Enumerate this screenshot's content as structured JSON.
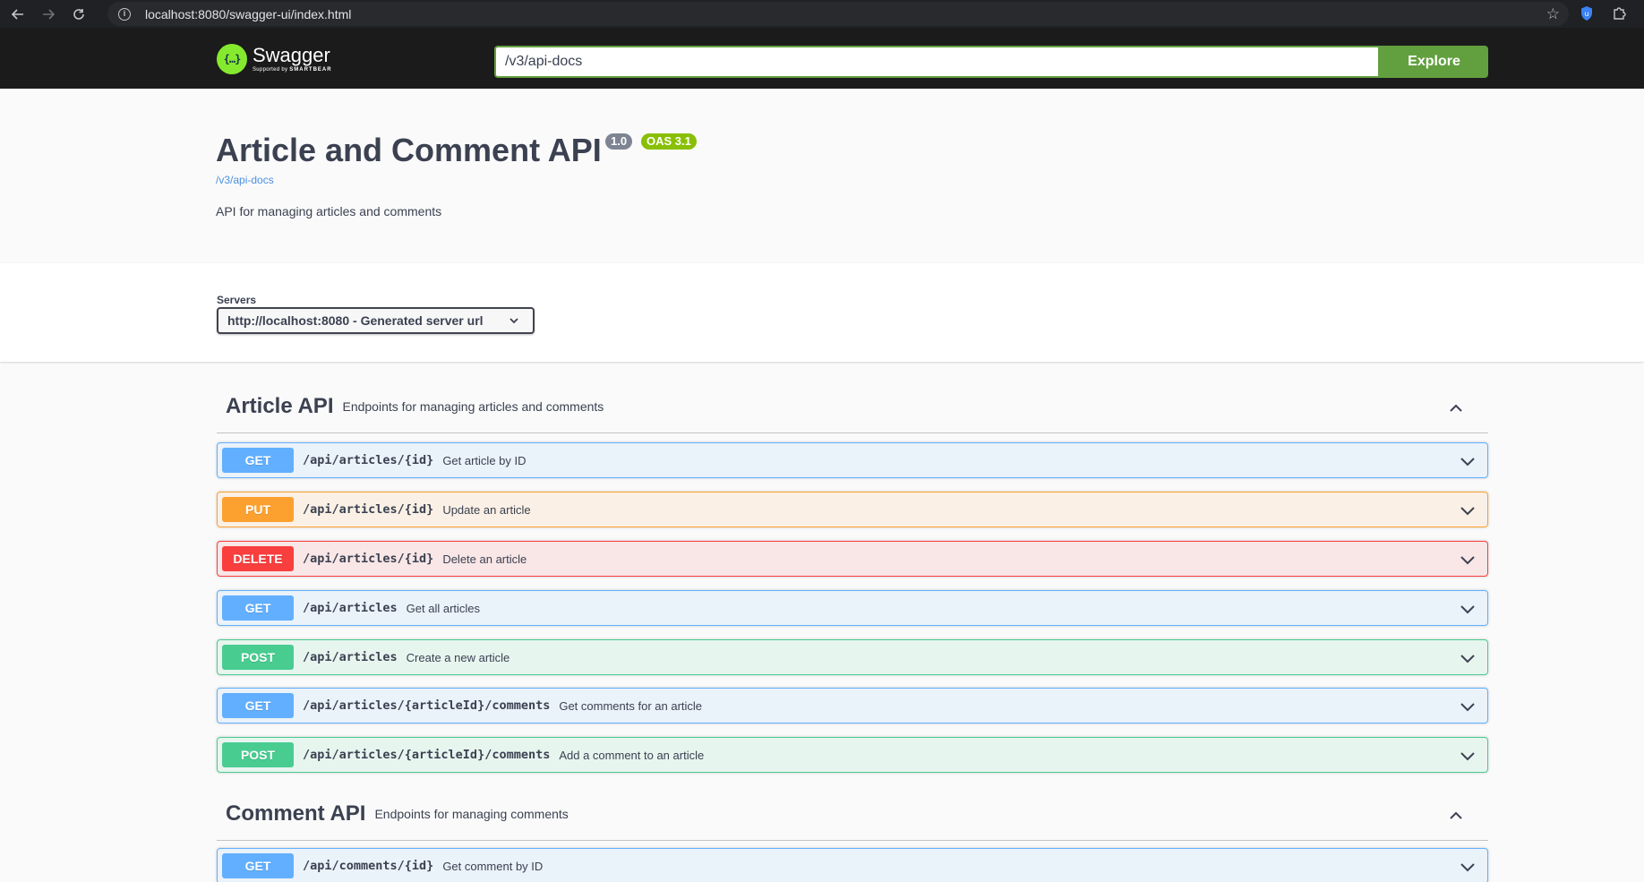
{
  "browser": {
    "url": "localhost:8080/swagger-ui/index.html",
    "back_icon": "arrow-left-icon",
    "forward_icon": "arrow-right-icon",
    "reload_icon": "reload-icon"
  },
  "topbar": {
    "logo_title": "Swagger",
    "logo_sub_prefix": "Supported by ",
    "logo_sub_brand": "SMARTBEAR",
    "url_value": "/v3/api-docs",
    "explore_label": "Explore"
  },
  "info": {
    "title": "Article and Comment API",
    "version": "1.0",
    "oas": "OAS 3.1",
    "spec_link": "/v3/api-docs",
    "description": "API for managing articles and comments"
  },
  "servers": {
    "label": "Servers",
    "selected": "http://localhost:8080 - Generated server url"
  },
  "tags": [
    {
      "name": "Article API",
      "description": "Endpoints for managing articles and comments",
      "operations": [
        {
          "method": "GET",
          "path": "/api/articles/{id}",
          "summary": "Get article by ID"
        },
        {
          "method": "PUT",
          "path": "/api/articles/{id}",
          "summary": "Update an article"
        },
        {
          "method": "DELETE",
          "path": "/api/articles/{id}",
          "summary": "Delete an article"
        },
        {
          "method": "GET",
          "path": "/api/articles",
          "summary": "Get all articles"
        },
        {
          "method": "POST",
          "path": "/api/articles",
          "summary": "Create a new article"
        },
        {
          "method": "GET",
          "path": "/api/articles/{articleId}/comments",
          "summary": "Get comments for an article"
        },
        {
          "method": "POST",
          "path": "/api/articles/{articleId}/comments",
          "summary": "Add a comment to an article"
        }
      ]
    },
    {
      "name": "Comment API",
      "description": "Endpoints for managing comments",
      "operations": [
        {
          "method": "GET",
          "path": "/api/comments/{id}",
          "summary": "Get comment by ID"
        }
      ]
    }
  ],
  "colors": {
    "get": "#61affe",
    "put": "#fca130",
    "delete": "#f93e3e",
    "post": "#49cc90",
    "explore": "#62a03f",
    "oas_badge": "#89bf04",
    "version_badge": "#7d8492"
  }
}
